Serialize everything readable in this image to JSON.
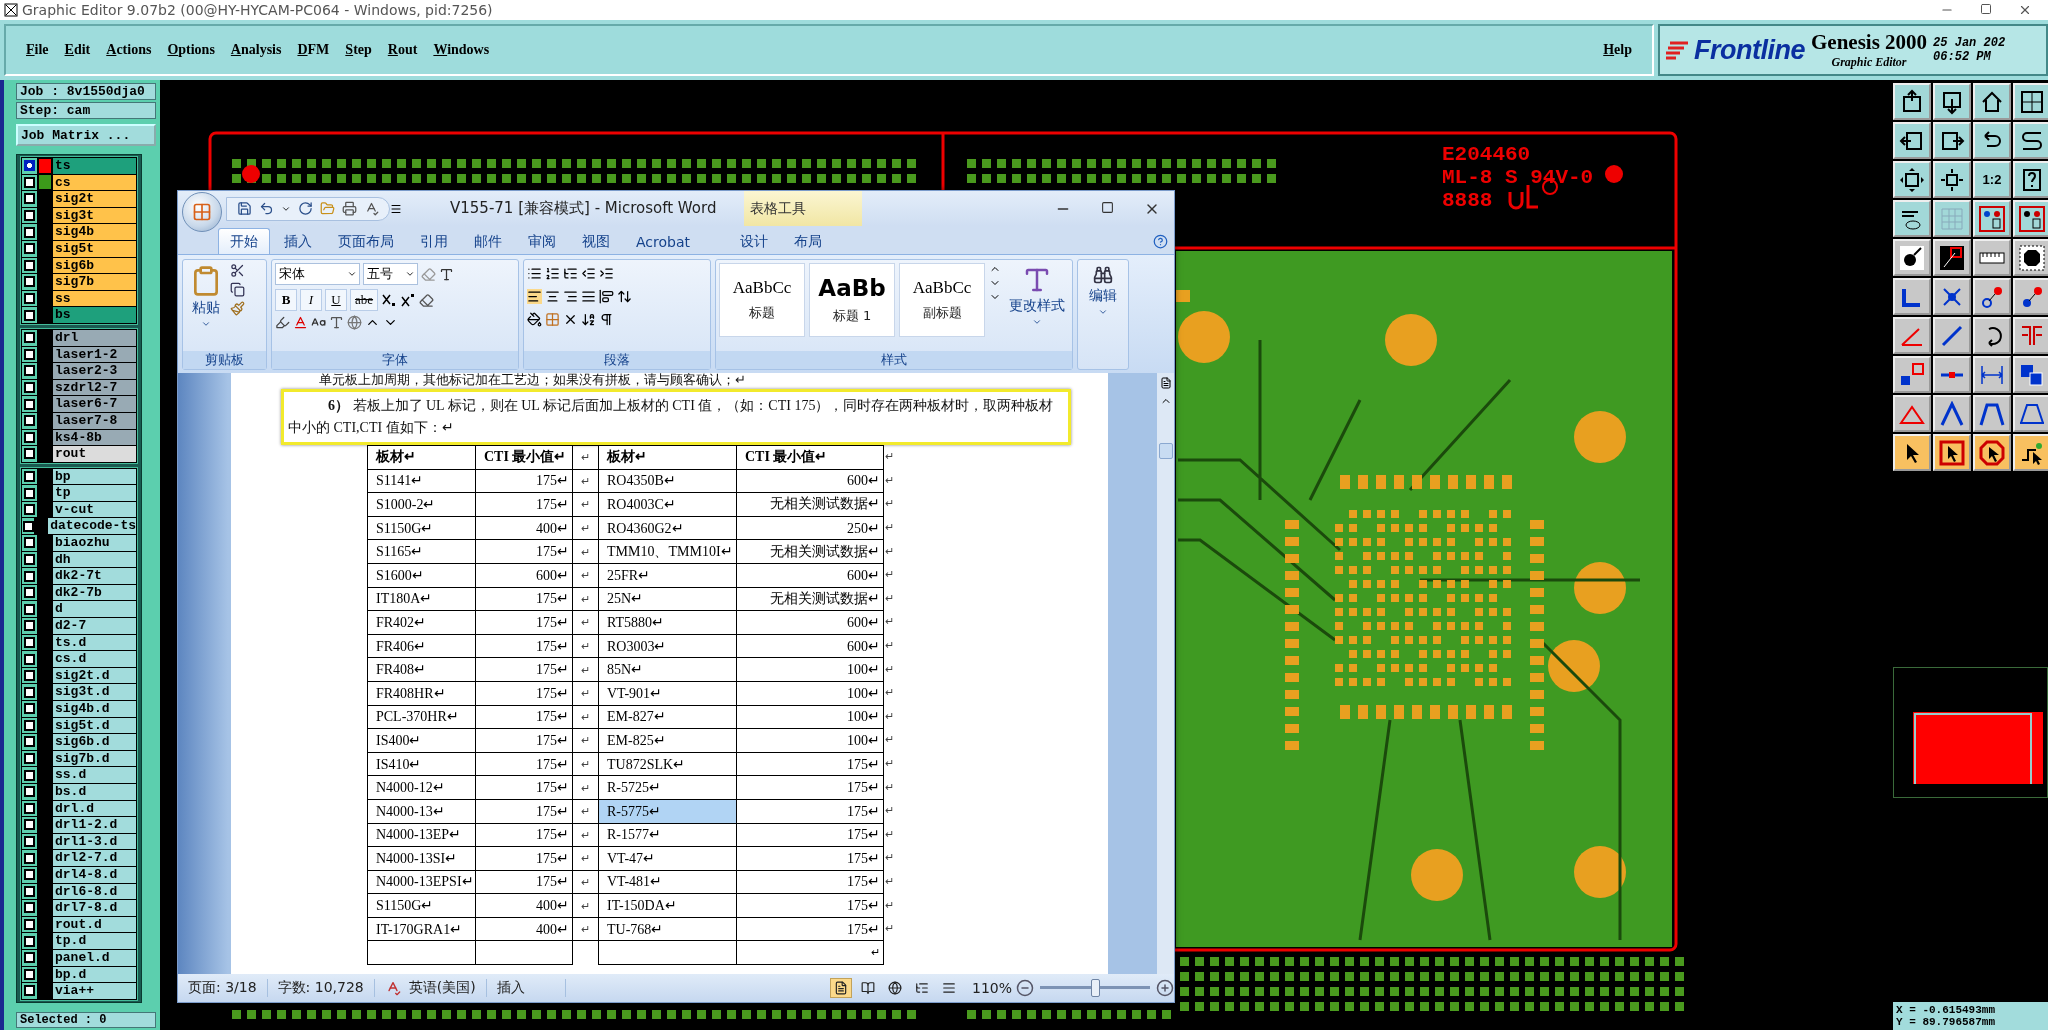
{
  "title_bar": {
    "title": "Graphic Editor 9.07b2 (00@HY-HYCAM-PC064 - Windows, pid:7256)"
  },
  "menu": [
    "File",
    "Edit",
    "Actions",
    "Options",
    "Analysis",
    "DFM",
    "Step",
    "Rout",
    "Windows"
  ],
  "help": "Help",
  "brand": {
    "logo": "Frontline",
    "product": "Genesis 2000",
    "subtitle": "Graphic Editor",
    "date": "25 Jan 202",
    "time": "06:52 PM"
  },
  "job_panel": {
    "job": "Job : 8v1550dja0",
    "step": "Step: cam",
    "matrix_button": "Job Matrix ...",
    "selected_count": "Selected : 0"
  },
  "layer_groups": [
    {
      "layers": [
        {
          "name": "ts",
          "color": "#1ea07c",
          "selected": true,
          "marker": {
            "color": "#ff0000"
          }
        },
        {
          "name": "cs",
          "color": "#ffc24a",
          "selected": false,
          "marker": {
            "color": "#3c9a1a"
          }
        },
        {
          "name": "sig2t",
          "color": "#ffc24a",
          "selected": false
        },
        {
          "name": "sig3t",
          "color": "#ffc24a",
          "selected": false
        },
        {
          "name": "sig4b",
          "color": "#ffc24a",
          "selected": false
        },
        {
          "name": "sig5t",
          "color": "#ffc24a",
          "selected": false
        },
        {
          "name": "sig6b",
          "color": "#ffc24a",
          "selected": false
        },
        {
          "name": "sig7b",
          "color": "#ffc24a",
          "selected": false
        },
        {
          "name": "ss",
          "color": "#ffc24a",
          "selected": false
        },
        {
          "name": "bs",
          "color": "#1ea07c",
          "selected": false
        }
      ]
    },
    {
      "layers": [
        {
          "name": "drl",
          "color": "#98aab4",
          "selected": false
        },
        {
          "name": "laser1-2",
          "color": "#98aab4",
          "selected": false
        },
        {
          "name": "laser2-3",
          "color": "#98aab4",
          "selected": false
        },
        {
          "name": "szdrl2-7",
          "color": "#98aab4",
          "selected": false
        },
        {
          "name": "laser6-7",
          "color": "#98aab4",
          "selected": false
        },
        {
          "name": "laser7-8",
          "color": "#98aab4",
          "selected": false
        },
        {
          "name": "ks4-8b",
          "color": "#98aab4",
          "selected": false
        },
        {
          "name": "rout",
          "color": "#dcdcdc",
          "selected": false
        }
      ]
    },
    {
      "layers": [
        {
          "name": "bp",
          "color": "#a2dcdc",
          "selected": false
        },
        {
          "name": "tp",
          "color": "#a2dcdc",
          "selected": false
        },
        {
          "name": "v-cut",
          "color": "#a2dcdc",
          "selected": false
        },
        {
          "name": "datecode-ts",
          "color": "#a2dcdc",
          "selected": false
        },
        {
          "name": "biaozhu",
          "color": "#a2dcdc",
          "selected": false
        },
        {
          "name": "dh",
          "color": "#a2dcdc",
          "selected": false
        },
        {
          "name": "dk2-7t",
          "color": "#a2dcdc",
          "selected": false
        },
        {
          "name": "dk2-7b",
          "color": "#a2dcdc",
          "selected": false
        },
        {
          "name": "d",
          "color": "#a2dcdc",
          "selected": false
        },
        {
          "name": "d2-7",
          "color": "#a2dcdc",
          "selected": false
        },
        {
          "name": "ts.d",
          "color": "#a2dcdc",
          "selected": false
        },
        {
          "name": "cs.d",
          "color": "#a2dcdc",
          "selected": false
        },
        {
          "name": "sig2t.d",
          "color": "#a2dcdc",
          "selected": false
        },
        {
          "name": "sig3t.d",
          "color": "#a2dcdc",
          "selected": false
        },
        {
          "name": "sig4b.d",
          "color": "#a2dcdc",
          "selected": false
        },
        {
          "name": "sig5t.d",
          "color": "#a2dcdc",
          "selected": false
        },
        {
          "name": "sig6b.d",
          "color": "#a2dcdc",
          "selected": false
        },
        {
          "name": "sig7b.d",
          "color": "#a2dcdc",
          "selected": false
        },
        {
          "name": "ss.d",
          "color": "#a2dcdc",
          "selected": false
        },
        {
          "name": "bs.d",
          "color": "#a2dcdc",
          "selected": false
        },
        {
          "name": "drl.d",
          "color": "#a2dcdc",
          "selected": false
        },
        {
          "name": "drl1-2.d",
          "color": "#a2dcdc",
          "selected": false
        },
        {
          "name": "drl1-3.d",
          "color": "#a2dcdc",
          "selected": false
        },
        {
          "name": "drl2-7.d",
          "color": "#a2dcdc",
          "selected": false
        },
        {
          "name": "drl4-8.d",
          "color": "#a2dcdc",
          "selected": false
        },
        {
          "name": "drl6-8.d",
          "color": "#a2dcdc",
          "selected": false
        },
        {
          "name": "drl7-8.d",
          "color": "#a2dcdc",
          "selected": false
        },
        {
          "name": "rout.d",
          "color": "#a2dcdc",
          "selected": false
        },
        {
          "name": "tp.d",
          "color": "#a2dcdc",
          "selected": false
        },
        {
          "name": "panel.d",
          "color": "#a2dcdc",
          "selected": false
        },
        {
          "name": "bp.d",
          "color": "#a2dcdc",
          "selected": false
        },
        {
          "name": "via++",
          "color": "#a2dcdc",
          "selected": false
        }
      ]
    }
  ],
  "canvas": {
    "silkscreen": [
      "E204460",
      "ML-8 S 94V-0",
      "8888"
    ]
  },
  "toolbar": {
    "scale_button": "1:2"
  },
  "coordinates": {
    "x": "X = -0.615493mm",
    "y": "Y = 89.796587mm"
  },
  "word": {
    "title": "V155-71 [兼容模式] - Microsoft Word",
    "context_tab": "表格工具",
    "tabs": [
      {
        "label": "开始",
        "selected": true
      },
      {
        "label": "插入",
        "selected": false
      },
      {
        "label": "页面布局",
        "selected": false
      },
      {
        "label": "引用",
        "selected": false
      },
      {
        "label": "邮件",
        "selected": false
      },
      {
        "label": "审阅",
        "selected": false
      },
      {
        "label": "视图",
        "selected": false
      },
      {
        "label": "Acrobat",
        "selected": false
      },
      {
        "label": "设计",
        "selected": false
      },
      {
        "label": "布局",
        "selected": false
      }
    ],
    "paste": "粘贴",
    "font_name": "宋体",
    "font_size": "五号",
    "format_buttons": [
      "B",
      "I",
      "U",
      "abe"
    ],
    "styles": [
      {
        "preview": "AaBbCc",
        "name": "标题",
        "kind": "normal"
      },
      {
        "preview": "AaBb",
        "name": "标题 1",
        "kind": "heading"
      },
      {
        "preview": "AaBbCc",
        "name": "副标题",
        "kind": "normal"
      }
    ],
    "change_styles": "更改样式",
    "editing": "编辑",
    "groups": [
      "剪贴板",
      "字体",
      "段落",
      "样式"
    ],
    "doc": {
      "prev_line": "单元板上加周期，其他标记加在工艺边；如果没有拼板，请与顾客确认；↵",
      "paragraph": "**6）** 若板上加了 UL 标记，则在 UL 标记后面加上板材的 CTI 值，（如：CTI 175），同时存在两种板材时，取两种板材中小的 CTI,CTI 值如下：↵",
      "table": {
        "header": [
          "板材↵",
          "CTI 最小值↵",
          "板材↵",
          "CTI 最小值↵"
        ],
        "header_gap": "↵",
        "header_end": "↵",
        "rows": [
          {
            "cells": [
              {
                "text": "S1141↵",
                "selected": false
              },
              {
                "text": "175↵",
                "selected": false
              },
              {
                "text": "RO4350B↵",
                "selected": false
              },
              {
                "text": "600↵",
                "selected": false
              }
            ],
            "gap": "↵",
            "end": "↵"
          },
          {
            "cells": [
              {
                "text": "S1000-2↵",
                "selected": false
              },
              {
                "text": "175↵",
                "selected": false
              },
              {
                "text": "RO4003C↵",
                "selected": false
              },
              {
                "text": "无相关测试数据↵",
                "selected": false
              }
            ],
            "gap": "↵",
            "end": "↵"
          },
          {
            "cells": [
              {
                "text": "S1150G↵",
                "selected": false
              },
              {
                "text": "400↵",
                "selected": false
              },
              {
                "text": "RO4360G2↵",
                "selected": false
              },
              {
                "text": "250↵",
                "selected": false
              }
            ],
            "gap": "↵",
            "end": "↵"
          },
          {
            "cells": [
              {
                "text": "S1165↵",
                "selected": false
              },
              {
                "text": "175↵",
                "selected": false
              },
              {
                "text": "TMM10、TMM10I↵",
                "selected": false
              },
              {
                "text": "无相关测试数据↵",
                "selected": false
              }
            ],
            "gap": "↵",
            "end": "↵"
          },
          {
            "cells": [
              {
                "text": "S1600↵",
                "selected": false
              },
              {
                "text": "600↵",
                "selected": false
              },
              {
                "text": "25FR↵",
                "selected": false
              },
              {
                "text": "600↵",
                "selected": false
              }
            ],
            "gap": "↵",
            "end": "↵"
          },
          {
            "cells": [
              {
                "text": "IT180A↵",
                "selected": false
              },
              {
                "text": "175↵",
                "selected": false
              },
              {
                "text": "25N↵",
                "selected": false
              },
              {
                "text": "无相关测试数据↵",
                "selected": false
              }
            ],
            "gap": "↵",
            "end": "↵"
          },
          {
            "cells": [
              {
                "text": "FR402↵",
                "selected": false
              },
              {
                "text": "175↵",
                "selected": false
              },
              {
                "text": "RT5880↵",
                "selected": false
              },
              {
                "text": "600↵",
                "selected": false
              }
            ],
            "gap": "↵",
            "end": "↵"
          },
          {
            "cells": [
              {
                "text": "FR406↵",
                "selected": false
              },
              {
                "text": "175↵",
                "selected": false
              },
              {
                "text": "RO3003↵",
                "selected": false
              },
              {
                "text": "600↵",
                "selected": false
              }
            ],
            "gap": "↵",
            "end": "↵"
          },
          {
            "cells": [
              {
                "text": "FR408↵",
                "selected": false
              },
              {
                "text": "175↵",
                "selected": false
              },
              {
                "text": "85N↵",
                "selected": false
              },
              {
                "text": "100↵",
                "selected": false
              }
            ],
            "gap": "↵",
            "end": "↵"
          },
          {
            "cells": [
              {
                "text": "FR408HR↵",
                "selected": false
              },
              {
                "text": "175↵",
                "selected": false
              },
              {
                "text": "VT-901↵",
                "selected": false
              },
              {
                "text": "100↵",
                "selected": false
              }
            ],
            "gap": "↵",
            "end": "↵"
          },
          {
            "cells": [
              {
                "text": "PCL-370HR↵",
                "selected": false
              },
              {
                "text": "175↵",
                "selected": false
              },
              {
                "text": "EM-827↵",
                "selected": false
              },
              {
                "text": "100↵",
                "selected": false
              }
            ],
            "gap": "↵",
            "end": "↵"
          },
          {
            "cells": [
              {
                "text": "IS400↵",
                "selected": false
              },
              {
                "text": "175↵",
                "selected": false
              },
              {
                "text": "EM-825↵",
                "selected": false
              },
              {
                "text": "100↵",
                "selected": false
              }
            ],
            "gap": "↵",
            "end": "↵"
          },
          {
            "cells": [
              {
                "text": "IS410↵",
                "selected": false
              },
              {
                "text": "175↵",
                "selected": false
              },
              {
                "text": "TU872SLK↵",
                "selected": false
              },
              {
                "text": "175↵",
                "selected": false
              }
            ],
            "gap": "↵",
            "end": "↵"
          },
          {
            "cells": [
              {
                "text": "N4000-12↵",
                "selected": false
              },
              {
                "text": "175↵",
                "selected": false
              },
              {
                "text": "R-5725↵",
                "selected": false
              },
              {
                "text": "175↵",
                "selected": false
              }
            ],
            "gap": "↵",
            "end": "↵"
          },
          {
            "cells": [
              {
                "text": "N4000-13↵",
                "selected": false
              },
              {
                "text": "175↵",
                "selected": false
              },
              {
                "text": "R-5775↵",
                "selected": true
              },
              {
                "text": "175↵",
                "selected": false
              }
            ],
            "gap": "↵",
            "end": "↵"
          },
          {
            "cells": [
              {
                "text": "N4000-13EP↵",
                "selected": false
              },
              {
                "text": "175↵",
                "selected": false
              },
              {
                "text": "R-1577↵",
                "selected": false
              },
              {
                "text": "175↵",
                "selected": false
              }
            ],
            "gap": "↵",
            "end": "↵"
          },
          {
            "cells": [
              {
                "text": "N4000-13SI↵",
                "selected": false
              },
              {
                "text": "175↵",
                "selected": false
              },
              {
                "text": "VT-47↵",
                "selected": false
              },
              {
                "text": "175↵",
                "selected": false
              }
            ],
            "gap": "↵",
            "end": "↵"
          },
          {
            "cells": [
              {
                "text": "N4000-13EPSI↵",
                "selected": false
              },
              {
                "text": "175↵",
                "selected": false
              },
              {
                "text": "VT-481↵",
                "selected": false
              },
              {
                "text": "175↵",
                "selected": false
              }
            ],
            "gap": "↵",
            "end": "↵"
          },
          {
            "cells": [
              {
                "text": "S1150G↵",
                "selected": false
              },
              {
                "text": "400↵",
                "selected": false
              },
              {
                "text": "IT-150DA↵",
                "selected": false
              },
              {
                "text": "175↵",
                "selected": false
              }
            ],
            "gap": "↵",
            "end": "↵"
          },
          {
            "cells": [
              {
                "text": "IT-170GRA1↵",
                "selected": false
              },
              {
                "text": "400↵",
                "selected": false
              },
              {
                "text": "TU-768↵",
                "selected": false
              },
              {
                "text": "175↵",
                "selected": false
              }
            ],
            "gap": "↵",
            "end": "↵"
          }
        ],
        "trailing_mark": "↵"
      }
    },
    "status": {
      "page": "页面: 3/18",
      "words": "字数: 10,728",
      "language": "英语(美国)",
      "mode": "插入",
      "zoom": "110%",
      "zoom_slider": {
        "level": 0.5
      }
    }
  }
}
